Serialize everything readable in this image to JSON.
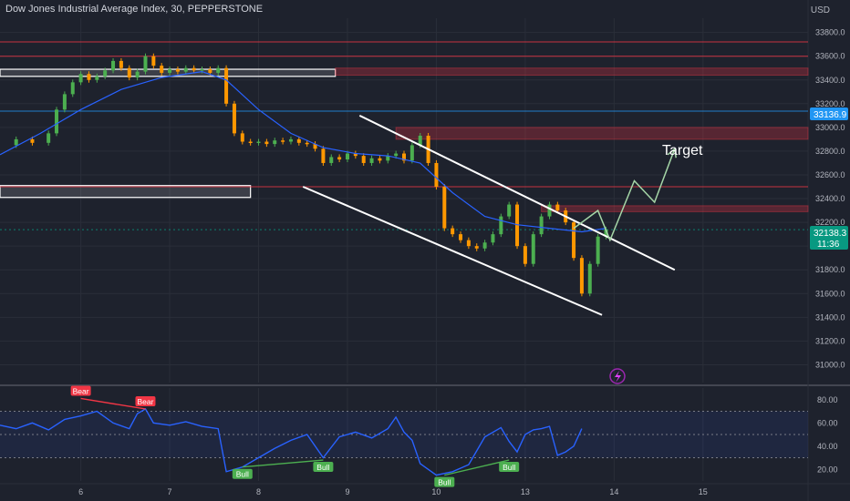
{
  "header": {
    "title": "Dow Jones Industrial Average Index, 30, PEPPERSTONE",
    "currency": "USD"
  },
  "annotations": {
    "target_label": "Target"
  },
  "price_labels": {
    "level_line": "33136.9",
    "last_price": "32138.3",
    "countdown": "11:36"
  },
  "colors": {
    "background": "#1e222d",
    "candle_up": "#4caf50",
    "candle_down": "#ff9800",
    "ma_line": "#2962ff",
    "rsi_line": "#2962ff",
    "channel": "#ffffff",
    "level_blue": "#2196f3",
    "price_badge": "#089981",
    "bear": "#f23645",
    "bull": "#4caf50",
    "zone": "#f2364544",
    "projection": "#a5d6a7"
  },
  "chart_data": [
    {
      "type": "line",
      "name": "price-panel",
      "ylim": [
        30850,
        33920
      ],
      "xlim": [
        0,
        100
      ],
      "ytick_labels": [
        "33800.0",
        "33600.0",
        "33400.0",
        "33200.0",
        "33000.0",
        "32800.0",
        "32600.0",
        "32400.0",
        "32200.0",
        "32000.0",
        "31800.0",
        "31600.0",
        "31400.0",
        "31200.0",
        "31000.0"
      ],
      "ytick_values": [
        33800,
        33600,
        33400,
        33200,
        33000,
        32800,
        32600,
        32400,
        32200,
        32000,
        31800,
        31600,
        31400,
        31200,
        31000
      ],
      "xtick_labels": [
        "6",
        "7",
        "8",
        "9",
        "10",
        "13",
        "14",
        "15"
      ],
      "xtick_values": [
        10,
        21,
        32,
        43,
        54,
        65,
        76,
        87
      ],
      "price_path": [
        [
          0,
          32850
        ],
        [
          2,
          32900
        ],
        [
          4,
          32870
        ],
        [
          6,
          32950
        ],
        [
          7,
          33150
        ],
        [
          8,
          33280
        ],
        [
          9,
          33380
        ],
        [
          10,
          33450
        ],
        [
          11,
          33400
        ],
        [
          12,
          33430
        ],
        [
          13,
          33480
        ],
        [
          14,
          33560
        ],
        [
          15,
          33500
        ],
        [
          16,
          33420
        ],
        [
          17,
          33470
        ],
        [
          18,
          33600
        ],
        [
          19,
          33520
        ],
        [
          20,
          33460
        ],
        [
          21,
          33490
        ],
        [
          22,
          33470
        ],
        [
          23,
          33500
        ],
        [
          24,
          33480
        ],
        [
          25,
          33490
        ],
        [
          26,
          33460
        ],
        [
          27,
          33500
        ],
        [
          28,
          33200
        ],
        [
          29,
          32950
        ],
        [
          30,
          32880
        ],
        [
          31,
          32870
        ],
        [
          32,
          32880
        ],
        [
          33,
          32860
        ],
        [
          34,
          32890
        ],
        [
          35,
          32880
        ],
        [
          36,
          32900
        ],
        [
          37,
          32870
        ],
        [
          38,
          32860
        ],
        [
          39,
          32820
        ],
        [
          40,
          32700
        ],
        [
          41,
          32750
        ],
        [
          42,
          32730
        ],
        [
          43,
          32780
        ],
        [
          44,
          32760
        ],
        [
          45,
          32700
        ],
        [
          46,
          32740
        ],
        [
          47,
          32720
        ],
        [
          48,
          32760
        ],
        [
          49,
          32780
        ],
        [
          50,
          32720
        ],
        [
          51,
          32850
        ],
        [
          52,
          32930
        ],
        [
          53,
          32700
        ],
        [
          54,
          32500
        ],
        [
          55,
          32150
        ],
        [
          56,
          32100
        ],
        [
          57,
          32050
        ],
        [
          58,
          32000
        ],
        [
          59,
          31980
        ],
        [
          60,
          32030
        ],
        [
          61,
          32100
        ],
        [
          62,
          32250
        ],
        [
          63,
          32350
        ],
        [
          64,
          32000
        ],
        [
          65,
          31850
        ],
        [
          66,
          32100
        ],
        [
          67,
          32250
        ],
        [
          68,
          32350
        ],
        [
          69,
          32300
        ],
        [
          70,
          32200
        ],
        [
          71,
          31900
        ],
        [
          72,
          31600
        ],
        [
          73,
          31850
        ],
        [
          74,
          32080
        ],
        [
          75,
          32140
        ]
      ],
      "ma_path": [
        [
          0,
          32770
        ],
        [
          5,
          32950
        ],
        [
          10,
          33150
        ],
        [
          15,
          33320
        ],
        [
          20,
          33420
        ],
        [
          25,
          33470
        ],
        [
          28,
          33400
        ],
        [
          32,
          33150
        ],
        [
          36,
          32950
        ],
        [
          40,
          32830
        ],
        [
          44,
          32780
        ],
        [
          48,
          32760
        ],
        [
          52,
          32700
        ],
        [
          56,
          32450
        ],
        [
          60,
          32250
        ],
        [
          64,
          32180
        ],
        [
          68,
          32150
        ],
        [
          72,
          32120
        ],
        [
          75,
          32150
        ]
      ],
      "channel_upper": [
        [
          44.5,
          33100
        ],
        [
          83.5,
          31800
        ]
      ],
      "channel_lower": [
        [
          37.5,
          32500
        ],
        [
          74.5,
          31420
        ]
      ],
      "projection_path": [
        [
          71,
          32150
        ],
        [
          74,
          32300
        ],
        [
          75.5,
          32050
        ],
        [
          78.5,
          32550
        ],
        [
          81,
          32370
        ],
        [
          83.5,
          32820
        ]
      ],
      "level_lines": [
        {
          "value": 33720,
          "color": "#f23645"
        },
        {
          "value": 33600,
          "color": "#f23645"
        },
        {
          "value": 33136.9,
          "color": "#2196f3"
        },
        {
          "value": 32500,
          "color": "#f23645"
        },
        {
          "value": 32138.3,
          "color": "#089981"
        }
      ],
      "zones": [
        {
          "x": [
            0,
            41.5
          ],
          "y": [
            33430,
            33490
          ],
          "style": "white-box"
        },
        {
          "x": [
            41.5,
            100
          ],
          "y": [
            33440,
            33500
          ],
          "style": "red-zone"
        },
        {
          "x": [
            49,
            100
          ],
          "y": [
            32900,
            33000
          ],
          "style": "red-zone"
        },
        {
          "x": [
            0,
            31
          ],
          "y": [
            32410,
            32510
          ],
          "style": "white-box"
        },
        {
          "x": [
            67,
            100
          ],
          "y": [
            32290,
            32340
          ],
          "style": "red-zone"
        }
      ]
    },
    {
      "type": "line",
      "name": "rsi-panel",
      "ylim": [
        10,
        90
      ],
      "xlim": [
        0,
        100
      ],
      "ytick_labels": [
        "80.00",
        "60.00",
        "40.00",
        "20.00"
      ],
      "ytick_values": [
        80,
        60,
        40,
        20
      ],
      "band": [
        30,
        70
      ],
      "midline": 50,
      "series": [
        {
          "values": [
            [
              0,
              58
            ],
            [
              2,
              55
            ],
            [
              4,
              60
            ],
            [
              6,
              54
            ],
            [
              8,
              63
            ],
            [
              10,
              66
            ],
            [
              12,
              70
            ],
            [
              14,
              60
            ],
            [
              16,
              55
            ],
            [
              17,
              68
            ],
            [
              18,
              72
            ],
            [
              19,
              60
            ],
            [
              21,
              58
            ],
            [
              23,
              61
            ],
            [
              25,
              57
            ],
            [
              27,
              55
            ],
            [
              28,
              18
            ],
            [
              30,
              22
            ],
            [
              32,
              30
            ],
            [
              34,
              38
            ],
            [
              36,
              45
            ],
            [
              38,
              50
            ],
            [
              40,
              30
            ],
            [
              42,
              48
            ],
            [
              44,
              52
            ],
            [
              46,
              47
            ],
            [
              48,
              55
            ],
            [
              49,
              65
            ],
            [
              50,
              52
            ],
            [
              51,
              45
            ],
            [
              52,
              25
            ],
            [
              53,
              20
            ],
            [
              54,
              15
            ],
            [
              56,
              18
            ],
            [
              58,
              24
            ],
            [
              60,
              48
            ],
            [
              62,
              56
            ],
            [
              63,
              44
            ],
            [
              64,
              35
            ],
            [
              65,
              50
            ],
            [
              66,
              54
            ],
            [
              67,
              55
            ],
            [
              68,
              57
            ],
            [
              69,
              32
            ],
            [
              70,
              35
            ],
            [
              71,
              40
            ],
            [
              72,
              55
            ]
          ]
        }
      ],
      "divergences": [
        {
          "label": "Bear",
          "from": [
            10,
            81
          ],
          "to": [
            18,
            72
          ],
          "kind": "bear"
        },
        {
          "label": "Bull",
          "from": [
            30,
            22
          ],
          "to": [
            40,
            28
          ],
          "kind": "bull"
        },
        {
          "label": "Bull",
          "from": [
            55,
            15
          ],
          "to": [
            63,
            28
          ],
          "kind": "bull"
        }
      ]
    }
  ]
}
